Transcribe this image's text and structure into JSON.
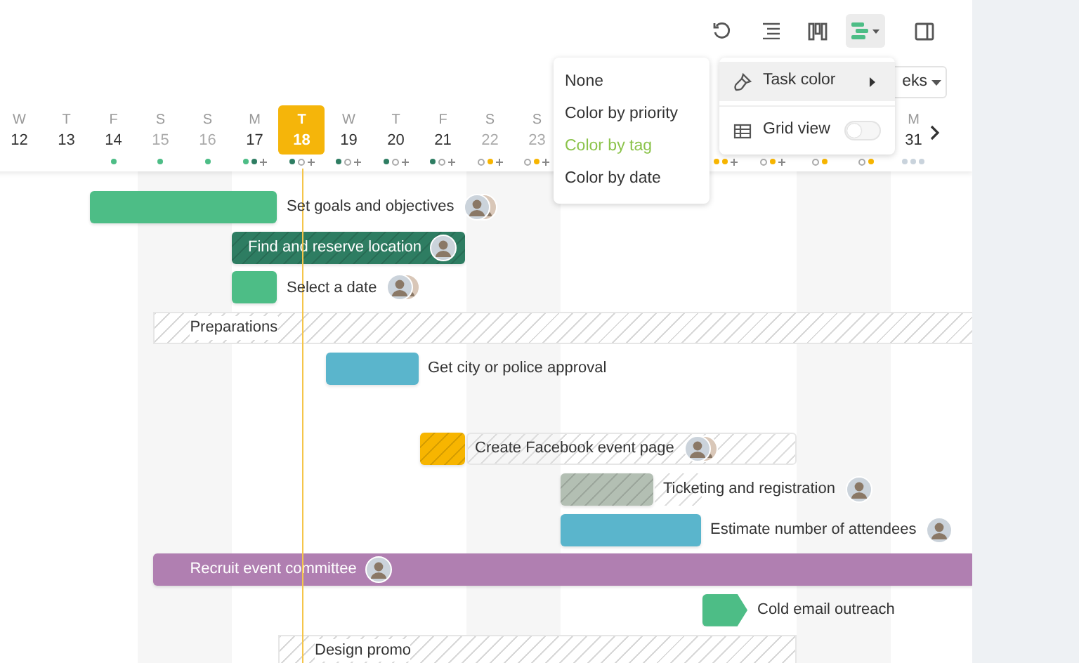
{
  "toolbar": {
    "buttons": [
      {
        "kind": "undo",
        "selected": false
      },
      {
        "kind": "outline",
        "selected": false
      },
      {
        "kind": "board",
        "selected": false
      },
      {
        "kind": "gantt",
        "selected": true
      },
      {
        "kind": "panel",
        "selected": false
      }
    ]
  },
  "view_select": {
    "label": "eks"
  },
  "timeline": {
    "days": [
      {
        "weekday": "W",
        "date": "12",
        "weekend": false,
        "today": false
      },
      {
        "weekday": "T",
        "date": "13",
        "weekend": false,
        "today": false
      },
      {
        "weekday": "F",
        "date": "14",
        "weekend": false,
        "today": false,
        "dots": [
          {
            "kind": "dot",
            "color": "#4dbd86"
          }
        ]
      },
      {
        "weekday": "S",
        "date": "15",
        "weekend": true,
        "today": false,
        "dots": [
          {
            "kind": "dot",
            "color": "#4dbd86"
          }
        ]
      },
      {
        "weekday": "S",
        "date": "16",
        "weekend": true,
        "today": false,
        "dots": [
          {
            "kind": "dot",
            "color": "#4dbd86"
          }
        ]
      },
      {
        "weekday": "M",
        "date": "17",
        "weekend": false,
        "today": false,
        "dots": [
          {
            "kind": "dot",
            "color": "#4dbd86"
          },
          {
            "kind": "dot",
            "color": "#2e7d62"
          },
          {
            "kind": "plus"
          }
        ]
      },
      {
        "weekday": "T",
        "date": "18",
        "weekend": false,
        "today": true,
        "dots": [
          {
            "kind": "dot",
            "color": "#2e7d62"
          },
          {
            "kind": "ring"
          },
          {
            "kind": "plus"
          }
        ]
      },
      {
        "weekday": "W",
        "date": "19",
        "weekend": false,
        "today": false,
        "dots": [
          {
            "kind": "dot",
            "color": "#2e7d62"
          },
          {
            "kind": "ring"
          },
          {
            "kind": "plus"
          }
        ]
      },
      {
        "weekday": "T",
        "date": "20",
        "weekend": false,
        "today": false,
        "dots": [
          {
            "kind": "dot",
            "color": "#2e7d62"
          },
          {
            "kind": "ring"
          },
          {
            "kind": "plus"
          }
        ]
      },
      {
        "weekday": "F",
        "date": "21",
        "weekend": false,
        "today": false,
        "dots": [
          {
            "kind": "dot",
            "color": "#2e7d62"
          },
          {
            "kind": "ring"
          },
          {
            "kind": "plus"
          }
        ]
      },
      {
        "weekday": "S",
        "date": "22",
        "weekend": true,
        "today": false,
        "dots": [
          {
            "kind": "ring"
          },
          {
            "kind": "dot",
            "color": "#f7b500"
          },
          {
            "kind": "plus"
          }
        ]
      },
      {
        "weekday": "S",
        "date": "23",
        "weekend": true,
        "today": false,
        "dots": [
          {
            "kind": "ring"
          },
          {
            "kind": "dot",
            "color": "#f7b500"
          },
          {
            "kind": "plus"
          }
        ]
      },
      {
        "weekend": false,
        "dots": [
          {
            "kind": "dot",
            "color": "#f7b500"
          },
          {
            "kind": "dot",
            "color": "#f7b500"
          },
          {
            "kind": "plus"
          }
        ]
      },
      {
        "weekend": false,
        "dots": [
          {
            "kind": "ring"
          },
          {
            "kind": "dot",
            "color": "#f7b500"
          },
          {
            "kind": "plus"
          }
        ]
      },
      {
        "weekend": true,
        "dots": [
          {
            "kind": "ring"
          },
          {
            "kind": "dot",
            "color": "#f7b500"
          }
        ]
      },
      {
        "weekend": true,
        "dots": [
          {
            "kind": "ring"
          },
          {
            "kind": "dot",
            "color": "#f7b500"
          }
        ]
      },
      {
        "weekday": "M",
        "date": "31",
        "weekend": false,
        "today": false,
        "dots": [
          {
            "kind": "dot",
            "color": "#c9d3dc"
          },
          {
            "kind": "dot",
            "color": "#c9d3dc"
          },
          {
            "kind": "dot",
            "color": "#c9d3dc"
          }
        ]
      }
    ]
  },
  "tasks": [
    {
      "kind": "bar",
      "label": "Set goals and objectives",
      "color": "#4dbd86",
      "hatched": false
    },
    {
      "kind": "bar",
      "label": "Find and reserve location",
      "color": "#2e7d62",
      "hatched": true
    },
    {
      "kind": "bar",
      "label": "Select a date",
      "color": "#4dbd86",
      "hatched": false
    },
    {
      "kind": "group",
      "label": "Preparations"
    },
    {
      "kind": "bar",
      "label": "Get city or police approval",
      "color": "#5ab5cc",
      "hatched": false
    },
    {
      "kind": "bar",
      "label": "Create Facebook event page",
      "color": "#f7b500",
      "hatched": true
    },
    {
      "kind": "bar",
      "label": "Ticketing and registration",
      "color": "#b3bfb3",
      "hatched": true
    },
    {
      "kind": "bar",
      "label": "Estimate number of attendees",
      "color": "#5ab5cc",
      "hatched": false
    },
    {
      "kind": "bar",
      "label": "Recruit event committee",
      "color": "#b07fb1",
      "hatched": false
    },
    {
      "kind": "milestone",
      "label": "Cold email outreach",
      "color": "#4dbd86"
    },
    {
      "kind": "group",
      "label": "Design promo"
    }
  ],
  "menu": {
    "items": [
      {
        "kind": "submenu",
        "label": "Task color",
        "selected": true
      },
      {
        "kind": "toggle",
        "label": "Grid view",
        "on": false
      }
    ]
  },
  "submenu": {
    "items": [
      {
        "label": "None",
        "selected": false
      },
      {
        "label": "Color by priority",
        "selected": false
      },
      {
        "label": "Color by tag",
        "selected": true
      },
      {
        "label": "Color by date",
        "selected": false
      }
    ]
  }
}
